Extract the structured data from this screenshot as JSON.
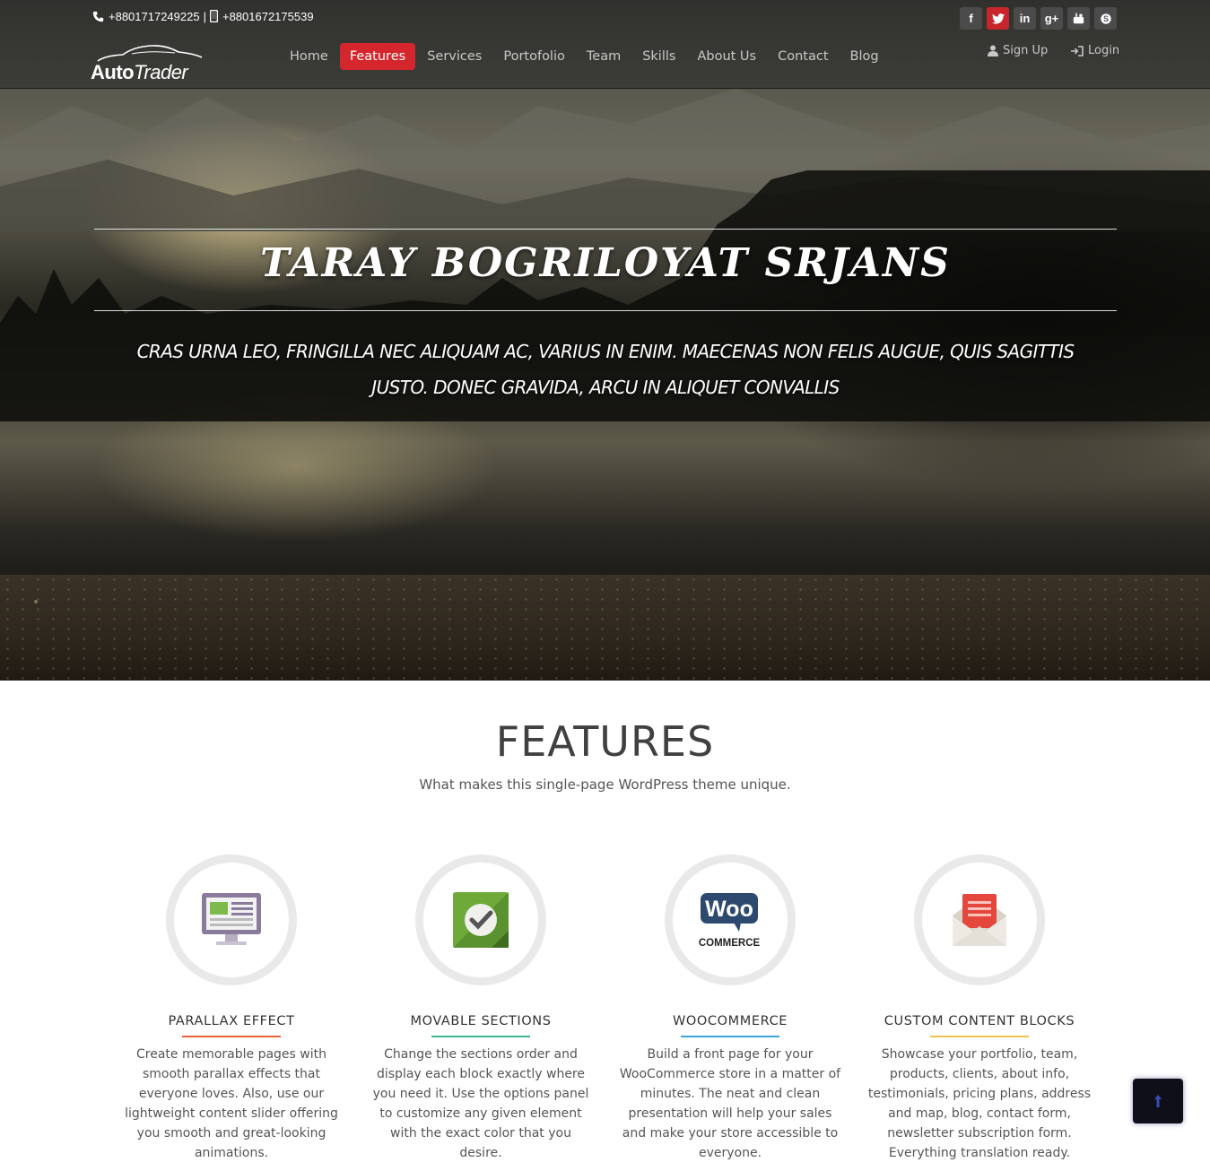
{
  "topbar": {
    "phone": "+8801717249225",
    "separator": "|",
    "mobile": "+8801672175539",
    "social": [
      {
        "icon": "facebook-icon",
        "glyph": "f"
      },
      {
        "icon": "twitter-icon",
        "glyph": "t"
      },
      {
        "icon": "linkedin-icon",
        "glyph": "in"
      },
      {
        "icon": "google-plus-icon",
        "glyph": "g+"
      },
      {
        "icon": "youtube-icon",
        "glyph": "▶"
      },
      {
        "icon": "skype-icon",
        "glyph": "S"
      }
    ],
    "signup": "Sign Up",
    "login": "Login"
  },
  "logo": {
    "bold": "Auto",
    "light": "Trader"
  },
  "nav": {
    "items": [
      "Home",
      "Features",
      "Services",
      "Portofolio",
      "Team",
      "Skills",
      "About Us",
      "Contact",
      "Blog"
    ],
    "active": "Features"
  },
  "hero": {
    "title": "TARAY BOGRILOYAT SRJANS",
    "subtitle": "Cras urna leo, fringilla nec aliquam ac, varius in enim. Maecenas non felis augue, quis sagittis justo. Donec gravida, arcu in aliquet convallis"
  },
  "features": {
    "title": "FEATURES",
    "subtitle": "What makes this single-page WordPress theme unique.",
    "items": [
      {
        "name": "PARALLAX EFFECT",
        "icon": "monitor-icon",
        "accent": "#e8633a",
        "desc": "Create memorable pages with smooth parallax effects that everyone loves. Also, use our lightweight content slider offering you smooth and great-looking animations."
      },
      {
        "name": "MOVABLE SECTIONS",
        "icon": "checkmark-icon",
        "accent": "#3fb58e",
        "desc": "Change the sections order and display each block exactly where you need it. Use the options panel to customize any given element with the exact color that you desire."
      },
      {
        "name": "WOOCOMMERCE",
        "icon": "woocommerce-icon",
        "accent": "#3aa5d8",
        "desc": "Build a front page for your WooCommerce store in a matter of minutes. The neat and clean presentation will help your sales and make your store accessible to everyone."
      },
      {
        "name": "CUSTOM CONTENT BLOCKS",
        "icon": "envelope-icon",
        "accent": "#f2c24a",
        "desc": "Showcase your portfolio, team, products, clients, about info, testimonials, pricing plans, address and map, blog, contact form, newsletter subscription form. Everything translation ready."
      }
    ]
  },
  "woo_logo": {
    "top": "Woo",
    "bottom": "COMMERCE"
  }
}
